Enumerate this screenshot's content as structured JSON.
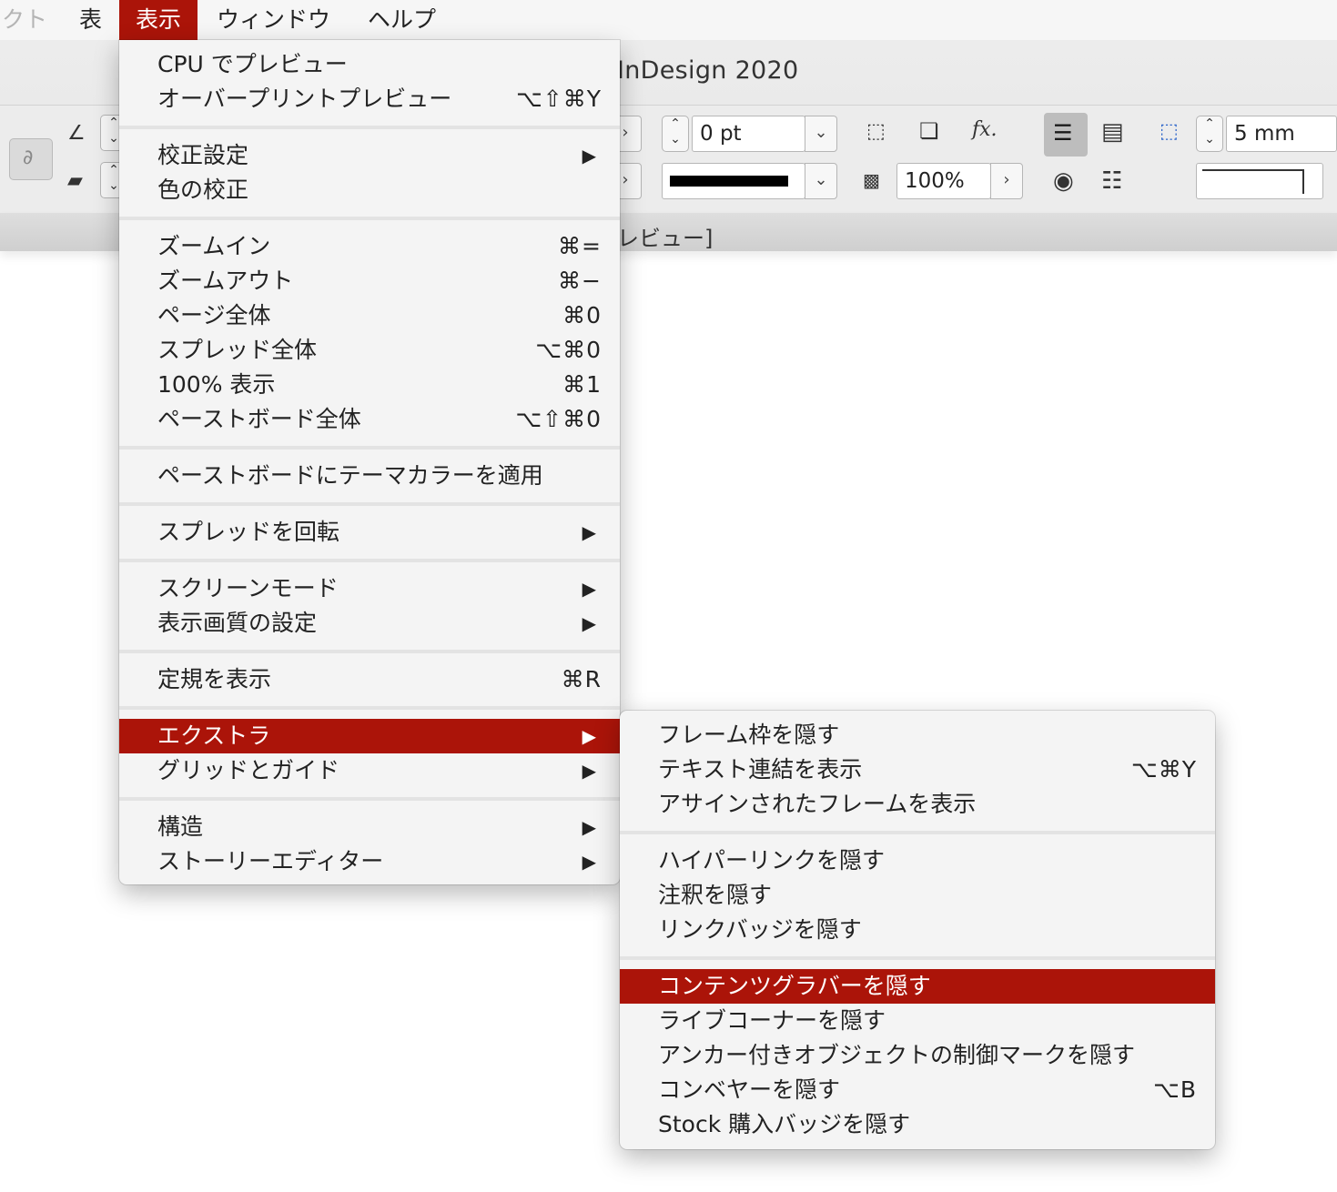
{
  "menubar": {
    "items": [
      "クト",
      "表",
      "表示",
      "ウィンドウ",
      "ヘルプ"
    ]
  },
  "app": {
    "title": "InDesign 2020",
    "doc_tab": "レビュー]"
  },
  "toolbar": {
    "stroke_weight": "0 pt",
    "opacity": "100%",
    "gap": "5 mm",
    "fx_label": "fx."
  },
  "view_menu": {
    "items": [
      {
        "label": "CPU でプレビュー",
        "shortcut": ""
      },
      {
        "label": "オーバープリントプレビュー",
        "shortcut": "⌥⇧⌘Y"
      },
      {
        "label": "校正設定",
        "submenu": "▶"
      },
      {
        "label": "色の校正",
        "shortcut": ""
      },
      {
        "label": "ズームイン",
        "shortcut": "⌘="
      },
      {
        "label": "ズームアウト",
        "shortcut": "⌘−"
      },
      {
        "label": "ページ全体",
        "shortcut": "⌘0"
      },
      {
        "label": "スプレッド全体",
        "shortcut": "⌥⌘0"
      },
      {
        "label": "100% 表示",
        "shortcut": "⌘1"
      },
      {
        "label": "ペーストボード全体",
        "shortcut": "⌥⇧⌘0"
      },
      {
        "label": "ペーストボードにテーマカラーを適用",
        "shortcut": ""
      },
      {
        "label": "スプレッドを回転",
        "submenu": "▶"
      },
      {
        "label": "スクリーンモード",
        "submenu": "▶"
      },
      {
        "label": "表示画質の設定",
        "submenu": "▶"
      },
      {
        "label": "定規を表示",
        "shortcut": "⌘R"
      },
      {
        "label": "エクストラ",
        "submenu": "▶"
      },
      {
        "label": "グリッドとガイド",
        "submenu": "▶"
      },
      {
        "label": "構造",
        "submenu": "▶"
      },
      {
        "label": "ストーリーエディター",
        "submenu": "▶"
      }
    ]
  },
  "extras_menu": {
    "items": [
      {
        "label": "フレーム枠を隠す",
        "shortcut": ""
      },
      {
        "label": "テキスト連結を表示",
        "shortcut": "⌥⌘Y"
      },
      {
        "label": "アサインされたフレームを表示",
        "shortcut": ""
      },
      {
        "label": "ハイパーリンクを隠す",
        "shortcut": ""
      },
      {
        "label": "注釈を隠す",
        "shortcut": ""
      },
      {
        "label": "リンクバッジを隠す",
        "shortcut": ""
      },
      {
        "label": "コンテンツグラバーを隠す",
        "shortcut": ""
      },
      {
        "label": "ライブコーナーを隠す",
        "shortcut": ""
      },
      {
        "label": "アンカー付きオブジェクトの制御マークを隠す",
        "shortcut": ""
      },
      {
        "label": "コンベヤーを隠す",
        "shortcut": "⌥B"
      },
      {
        "label": "Stock 購入バッジを隠す",
        "shortcut": ""
      }
    ]
  },
  "colors": {
    "highlight": "#ab1409"
  }
}
